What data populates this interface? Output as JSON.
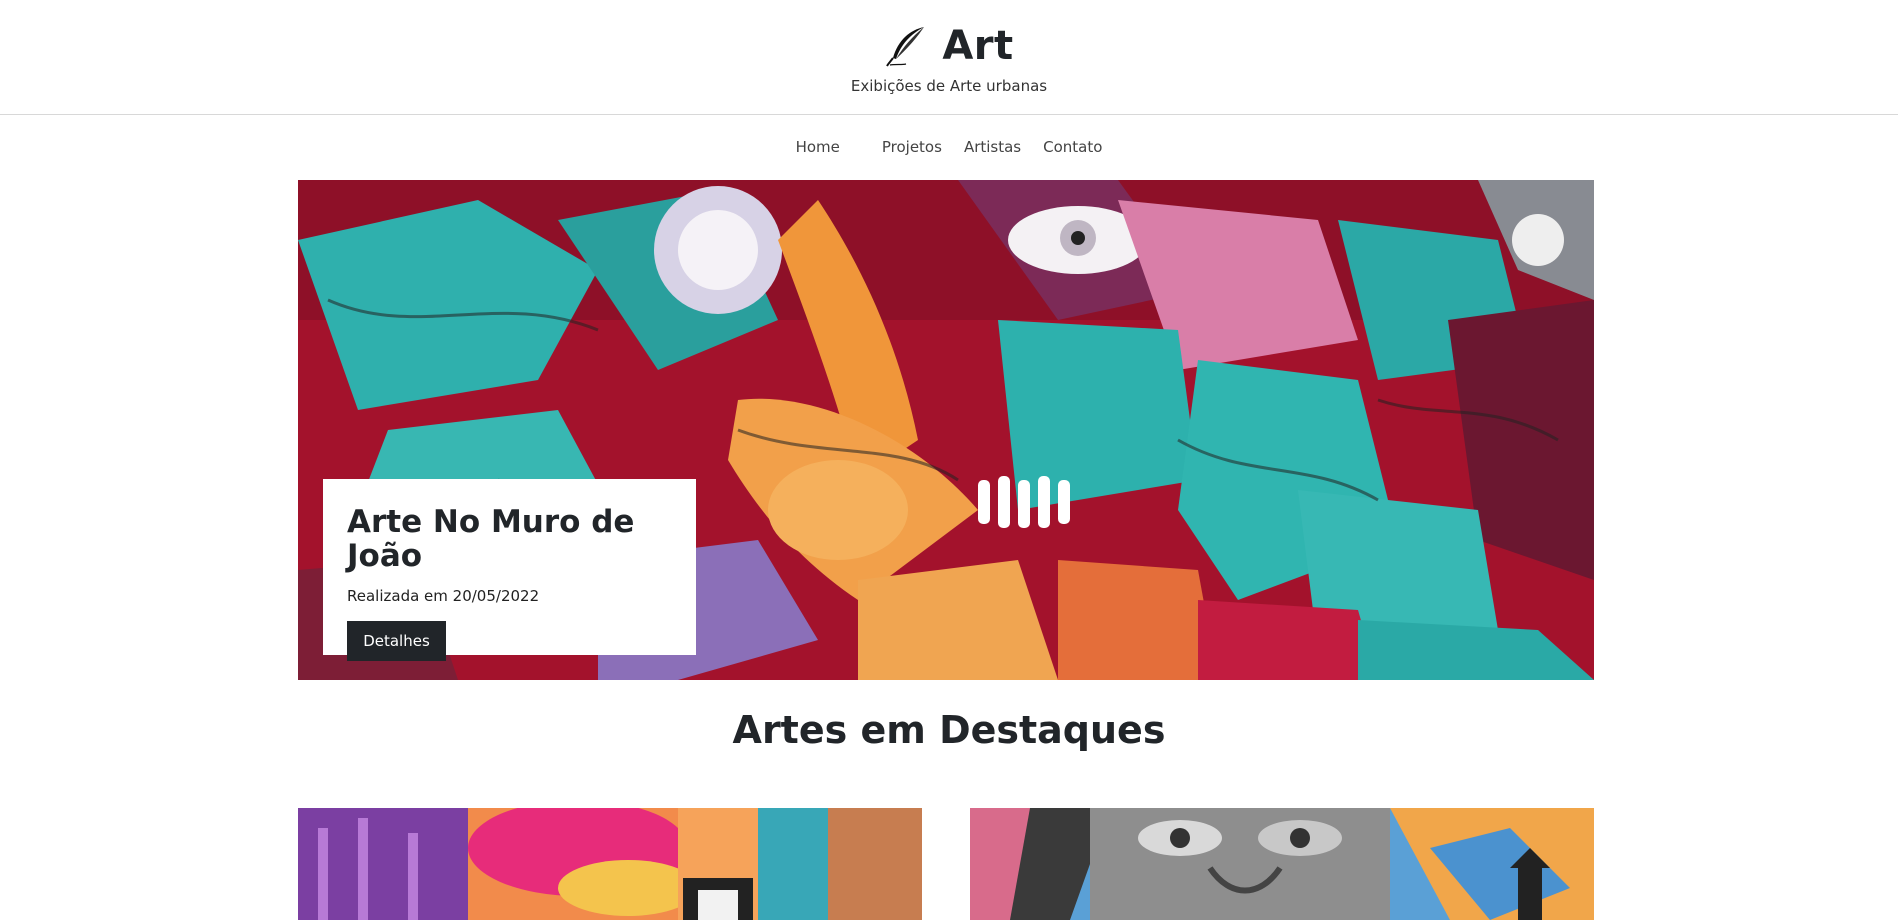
{
  "header": {
    "brand_title": "Art",
    "subtitle": "Exibições de Arte urbanas",
    "logo_icon": "feather-icon"
  },
  "nav": {
    "items": [
      "Home",
      "Projetos",
      "Artistas",
      "Contato"
    ]
  },
  "hero": {
    "title": "Arte No Muro de João",
    "date": "Realizada em 20/05/2022",
    "button_label": "Detalhes",
    "image": "graffiti-mural-image"
  },
  "featured": {
    "title": "Artes em Destaques",
    "images": [
      "colorful-mural-image",
      "portrait-mural-image"
    ]
  },
  "colors": {
    "dark": "#212529",
    "mural_red": "#a3122c",
    "mural_teal": "#2fb0ad",
    "mural_orange": "#f0963a",
    "mural_purple": "#8b6fb8"
  }
}
